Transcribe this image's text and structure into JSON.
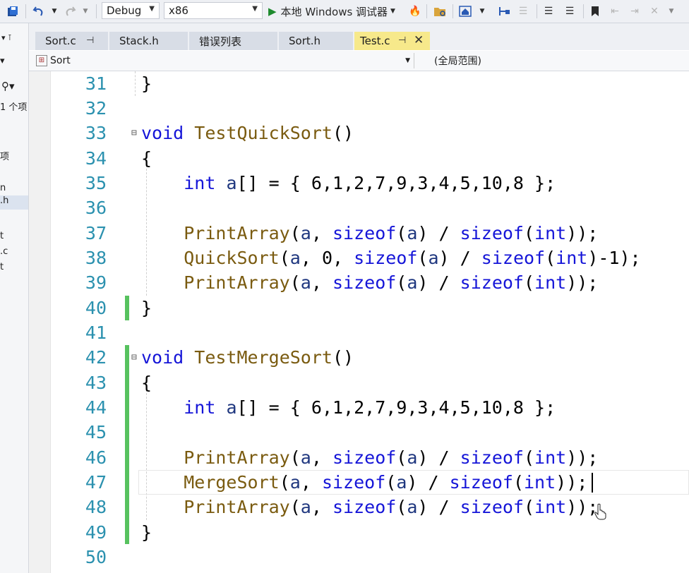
{
  "toolbar": {
    "config": "Debug",
    "platform": "x86",
    "run_label": "本地 Windows 调试器",
    "icons": [
      "save-all-icon",
      "undo-icon",
      "undo-dropdown-icon",
      "redo-icon",
      "redo-dropdown-icon",
      "run-icon",
      "hot-reload-icon",
      "folder-icon",
      "home-icon",
      "dropdown-icon",
      "step-icon",
      "indent-icon",
      "align-icon",
      "bookmark-icon",
      "prev-bookmark-icon",
      "next-bookmark-icon",
      "clear-bookmark-icon"
    ]
  },
  "left_panel": {
    "items": [
      "1 个项",
      "项",
      "n",
      ".h",
      "t",
      ".c",
      "t"
    ]
  },
  "tabs": [
    {
      "label": "Sort.c",
      "pinned": true,
      "active": false
    },
    {
      "label": "Stack.h",
      "active": false
    },
    {
      "label": "错误列表",
      "active": false
    },
    {
      "label": "Sort.h",
      "active": false
    },
    {
      "label": "Test.c",
      "pinned": true,
      "active": true
    }
  ],
  "navbar": {
    "scope_left": "Sort",
    "scope_right": "(全局范围)"
  },
  "editor": {
    "line_numbers": [
      "31",
      "32",
      "33",
      "34",
      "35",
      "36",
      "37",
      "38",
      "39",
      "40",
      "41",
      "42",
      "43",
      "44",
      "45",
      "46",
      "47",
      "48",
      "49",
      "50"
    ],
    "lines": [
      "}",
      "",
      "void TestQuickSort()",
      "{",
      "    int a[] = { 6,1,2,7,9,3,4,5,10,8 };",
      "",
      "    PrintArray(a, sizeof(a) / sizeof(int));",
      "    QuickSort(a, 0, sizeof(a) / sizeof(int)-1);",
      "    PrintArray(a, sizeof(a) / sizeof(int));",
      "}",
      "",
      "void TestMergeSort()",
      "{",
      "    int a[] = { 6,1,2,7,9,3,4,5,10,8 };",
      "",
      "    PrintArray(a, sizeof(a) / sizeof(int));",
      "    MergeSort(a, sizeof(a) / sizeof(int));",
      "    PrintArray(a, sizeof(a) / sizeof(int));",
      "}",
      ""
    ],
    "colors": {
      "keyword": "#1515d8",
      "function": "#7a5b10",
      "variable": "#1f377f",
      "line_number": "#2b91af",
      "change_bar": "#57c25f"
    }
  }
}
